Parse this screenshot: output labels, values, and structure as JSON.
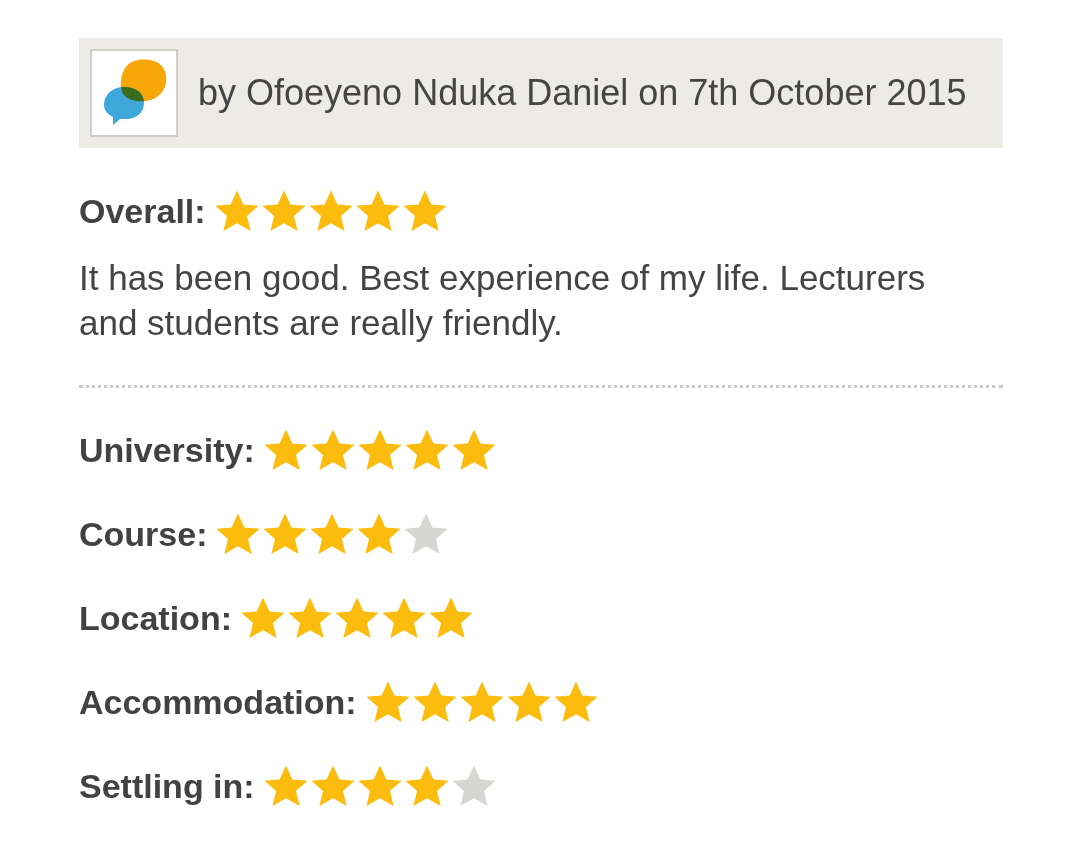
{
  "review": {
    "author_line": "by Ofoeyeno Nduka Daniel on 7th October 2015",
    "overall": {
      "label": "Overall:",
      "stars": 5
    },
    "comment": "It has been good. Best experience of my life. Lecturers and students are really friendly."
  },
  "ratings": [
    {
      "label": "University:",
      "stars": 5
    },
    {
      "label": "Course:",
      "stars": 4
    },
    {
      "label": "Location:",
      "stars": 5
    },
    {
      "label": "Accommodation:",
      "stars": 5
    },
    {
      "label": "Settling in:",
      "stars": 4
    }
  ]
}
